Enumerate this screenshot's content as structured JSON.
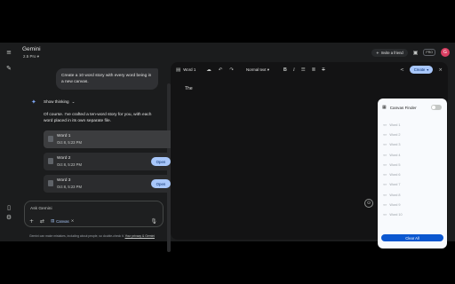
{
  "header": {
    "app_title": "Gemini",
    "model": "2.5 Pro",
    "invite_label": "Invite a friend",
    "pro_badge": "PRO",
    "avatar_letter": "G"
  },
  "chat": {
    "user_prompt": "Create a 10 word story with every word being in a new canvas.",
    "thinking_label": "Show thinking",
    "reply": "Of course. I've crafted a ten-word story for you, with each word placed in its own separate file.",
    "cards": [
      {
        "title": "Word 1",
        "date": "Oct 8, 5:23 PM",
        "button": ""
      },
      {
        "title": "Word 2",
        "date": "Oct 8, 5:23 PM",
        "button": "Open"
      },
      {
        "title": "Word 3",
        "date": "Oct 8, 5:23 PM",
        "button": "Open"
      }
    ],
    "input_placeholder": "Ask Gemini",
    "canvas_chip": "Canvas",
    "disclaimer_text": "Gemini can make mistakes, including about people, so double-check it. ",
    "disclaimer_link": "Your privacy & Gemini"
  },
  "canvas": {
    "doc_name": "Word 1",
    "style_select": "Normal text",
    "create_label": "Create",
    "body_text": "The"
  },
  "finder": {
    "title": "Canvas Finder",
    "items": [
      "Word 1",
      "Word 2",
      "Word 3",
      "Word 4",
      "Word 5",
      "Word 6",
      "Word 7",
      "Word 8",
      "Word 9",
      "Word 10"
    ],
    "clear_label": "Clear All"
  },
  "colors": {
    "accent": "#a8c7fa",
    "primary_button": "#0b57d0",
    "avatar": "#d93f62"
  }
}
